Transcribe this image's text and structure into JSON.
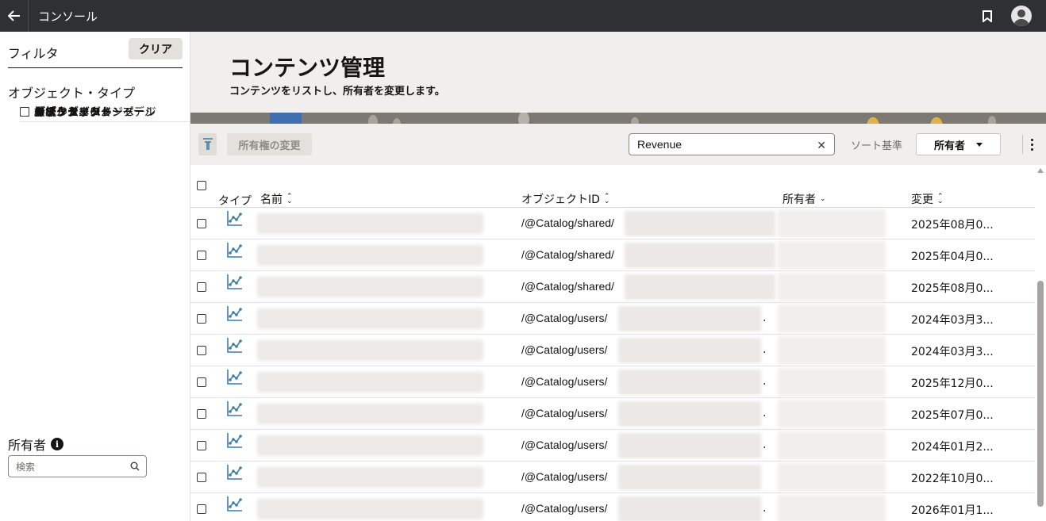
{
  "topbar": {
    "title": "コンソール"
  },
  "filters": {
    "title": "フィルタ",
    "clear_label": "クリア",
    "object_type_title": "オブジェクト・タイプ",
    "object_types": [
      {
        "label": "ワークブック",
        "checked": true
      },
      {
        "label": "ダッシュボード",
        "checked": false
      },
      {
        "label": "ダッシュボード・ページ",
        "checked": false
      },
      {
        "label": "分析",
        "checked": false
      },
      {
        "label": "レポート",
        "checked": false
      },
      {
        "label": "フォルダ",
        "checked": false
      },
      {
        "label": "接続",
        "checked": false
      },
      {
        "label": "データセット",
        "checked": false
      },
      {
        "label": "データ・フロー",
        "checked": false
      },
      {
        "label": "レプリケーション",
        "checked": false
      },
      {
        "label": "シーケンス",
        "checked": false
      },
      {
        "label": "モデル",
        "checked": false
      },
      {
        "label": "セマンティック・モデル",
        "checked": false
      },
      {
        "label": "ウォッチリスト",
        "checked": false
      },
      {
        "label": "カスタム・ページ",
        "checked": false
      },
      {
        "label": "カスタム・グループ",
        "checked": false
      },
      {
        "label": "AIエージェント",
        "checked": false
      }
    ],
    "owner_title": "所有者",
    "owner_info_glyph": "i",
    "owner_search_placeholder": "検索"
  },
  "page": {
    "title": "コンテンツ管理",
    "subtitle": "コンテンツをリストし、所有者を変更します。"
  },
  "toolbar": {
    "change_owner_label": "所有権の変更",
    "search_value": "Revenue",
    "clear_glyph": "✕",
    "sort_label": "ソート基準",
    "sort_value": "所有者"
  },
  "table": {
    "columns": {
      "type": "タイプ",
      "name": "名前",
      "object_id": "オブジェクトID",
      "owner": "所有者",
      "modified": "変更"
    },
    "sort_glyph_up": "⌃",
    "sort_glyph_down": "⌄",
    "ellipsis": ".",
    "rows": [
      {
        "object_id_prefix": "/@Catalog/shared/",
        "modified": "2025年08月0..."
      },
      {
        "object_id_prefix": "/@Catalog/shared/",
        "modified": "2025年04月0..."
      },
      {
        "object_id_prefix": "/@Catalog/shared/",
        "modified": "2025年08月0..."
      },
      {
        "object_id_prefix": "/@Catalog/users/",
        "modified": "2024年03月3..."
      },
      {
        "object_id_prefix": "/@Catalog/users/",
        "modified": "2024年03月3..."
      },
      {
        "object_id_prefix": "/@Catalog/users/",
        "modified": "2025年12月0..."
      },
      {
        "object_id_prefix": "/@Catalog/users/",
        "modified": "2025年07月0..."
      },
      {
        "object_id_prefix": "/@Catalog/users/",
        "modified": "2024年01月2..."
      },
      {
        "object_id_prefix": "/@Catalog/users/",
        "modified": "2022年10月0..."
      },
      {
        "object_id_prefix": "/@Catalog/users/",
        "modified": "2026年01月1..."
      }
    ]
  },
  "colors": {
    "topbar": "#2f3033",
    "banner": "#f1efed",
    "icon_accent": "#3b7fa6"
  }
}
